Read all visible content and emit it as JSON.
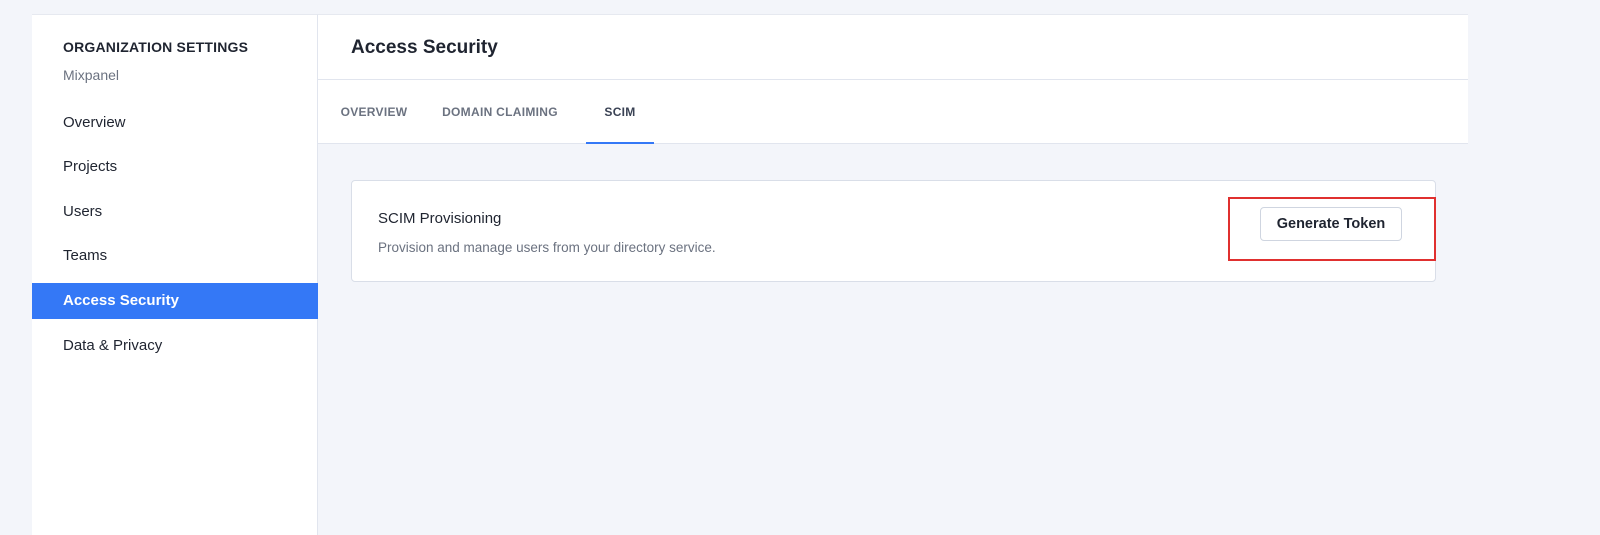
{
  "sidebar": {
    "header": "ORGANIZATION SETTINGS",
    "org_name": "Mixpanel",
    "items": [
      {
        "label": "Overview",
        "active": false
      },
      {
        "label": "Projects",
        "active": false
      },
      {
        "label": "Users",
        "active": false
      },
      {
        "label": "Teams",
        "active": false
      },
      {
        "label": "Access Security",
        "active": true
      },
      {
        "label": "Data & Privacy",
        "active": false
      }
    ]
  },
  "main": {
    "title": "Access Security",
    "tabs": [
      {
        "label": "OVERVIEW",
        "active": false
      },
      {
        "label": "DOMAIN CLAIMING",
        "active": false
      },
      {
        "label": "SCIM",
        "active": true
      }
    ],
    "scim_card": {
      "title": "SCIM Provisioning",
      "description": "Provision and manage users from your directory service.",
      "button_label": "Generate Token"
    }
  },
  "colors": {
    "accent": "#3478f6",
    "highlight": "#e0302f",
    "background": "#f3f5fa"
  }
}
